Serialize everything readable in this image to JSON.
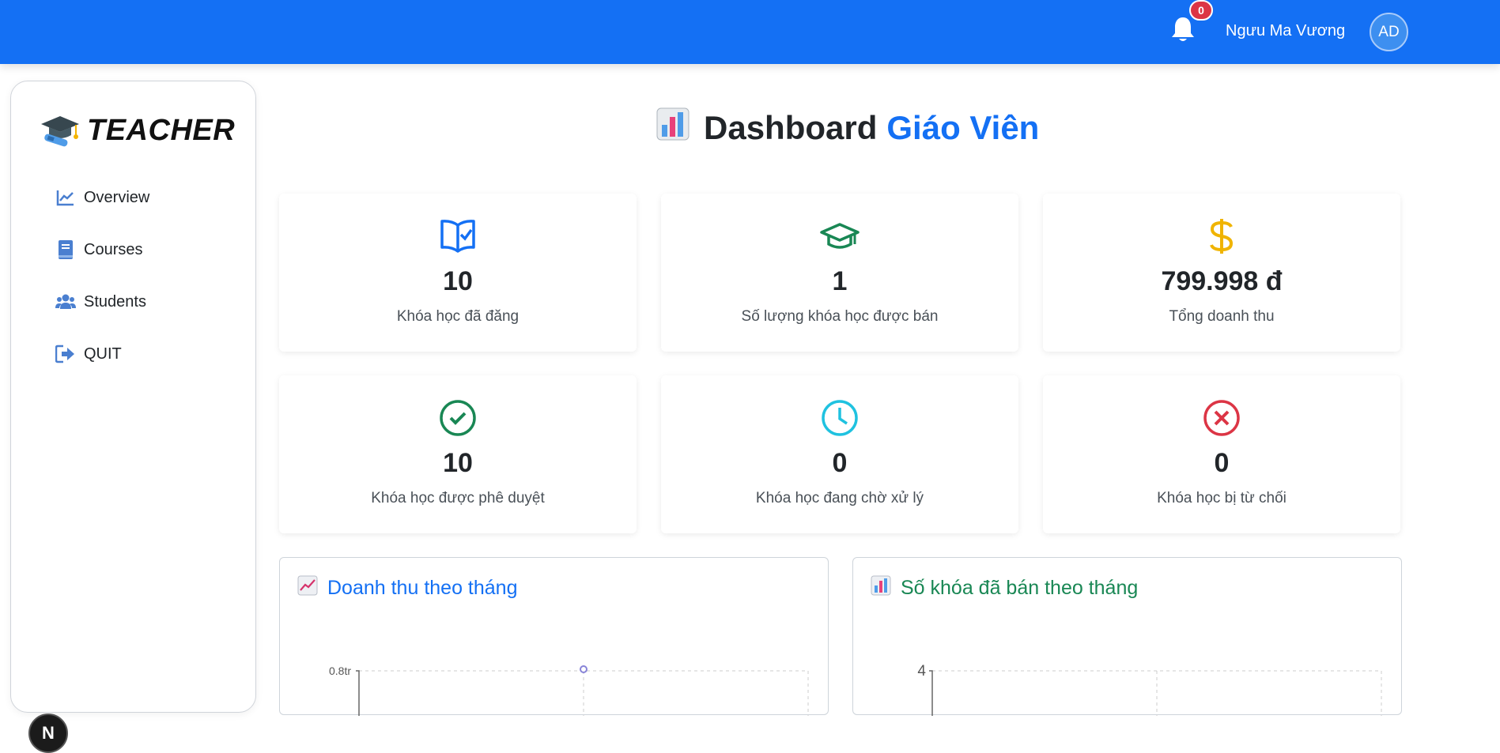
{
  "header": {
    "notification_count": "0",
    "user_name": "Ngưu Ma Vương",
    "avatar_initials": "AD",
    "colors": {
      "bar": "#1470f4",
      "badge": "#dc3545"
    }
  },
  "sidebar": {
    "brand": "TEACHER",
    "items": [
      {
        "label": "Overview",
        "icon": "line-chart-icon"
      },
      {
        "label": "Courses",
        "icon": "book-icon"
      },
      {
        "label": "Students",
        "icon": "users-icon"
      },
      {
        "label": "QUIT",
        "icon": "sign-out-icon"
      }
    ],
    "floating_button": "N"
  },
  "main": {
    "title_part1": "Dashboard",
    "title_part2": "Giáo Viên",
    "stats": [
      {
        "value": "10",
        "label": "Khóa học đã đăng",
        "icon": "book-check-icon",
        "color": "#1470f4"
      },
      {
        "value": "1",
        "label": "Số lượng khóa học được bán",
        "icon": "graduation-cap-icon",
        "color": "#198754"
      },
      {
        "value": "799.998 đ",
        "label": "Tổng doanh thu",
        "icon": "dollar-icon",
        "color": "#f0b400"
      },
      {
        "value": "10",
        "label": "Khóa học được phê duyệt",
        "icon": "check-circle-icon",
        "color": "#198754"
      },
      {
        "value": "0",
        "label": "Khóa học đang chờ xử lý",
        "icon": "clock-icon",
        "color": "#1fc2e0"
      },
      {
        "value": "0",
        "label": "Khóa học bị từ chối",
        "icon": "x-circle-icon",
        "color": "#dc3545"
      }
    ],
    "charts": [
      {
        "title": "Doanh thu theo tháng",
        "color": "#1470f4",
        "ytick_top": "0.8tr"
      },
      {
        "title": "Số khóa đã bán theo tháng",
        "color": "#198754",
        "ytick_top": "4"
      }
    ]
  }
}
